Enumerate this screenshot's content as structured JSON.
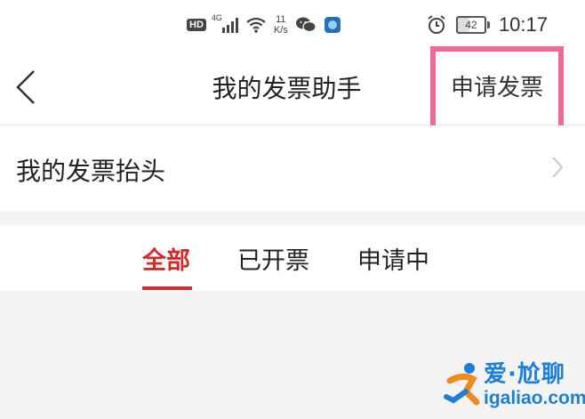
{
  "status_bar": {
    "hd_label": "HD",
    "network_label": "4G",
    "speed_value": "11",
    "speed_unit": "K/s",
    "battery_level": "42",
    "time": "10:17",
    "icons": [
      "hd-icon",
      "signal-icon",
      "wifi-icon",
      "wechat-icon",
      "app-icon",
      "alarm-icon",
      "battery-icon"
    ]
  },
  "navbar": {
    "title": "我的发票助手",
    "action_label": "申请发票",
    "highlight_color": "#ec6b93"
  },
  "invoice_header": {
    "label": "我的发票抬头"
  },
  "tabs": {
    "items": [
      {
        "label": "全部",
        "active": true
      },
      {
        "label": "已开票",
        "active": false
      },
      {
        "label": "申请中",
        "active": false
      }
    ],
    "active_color": "#d02c2c"
  },
  "watermark": {
    "line1": "爱·尬聊",
    "line2": "igaliao.com"
  }
}
